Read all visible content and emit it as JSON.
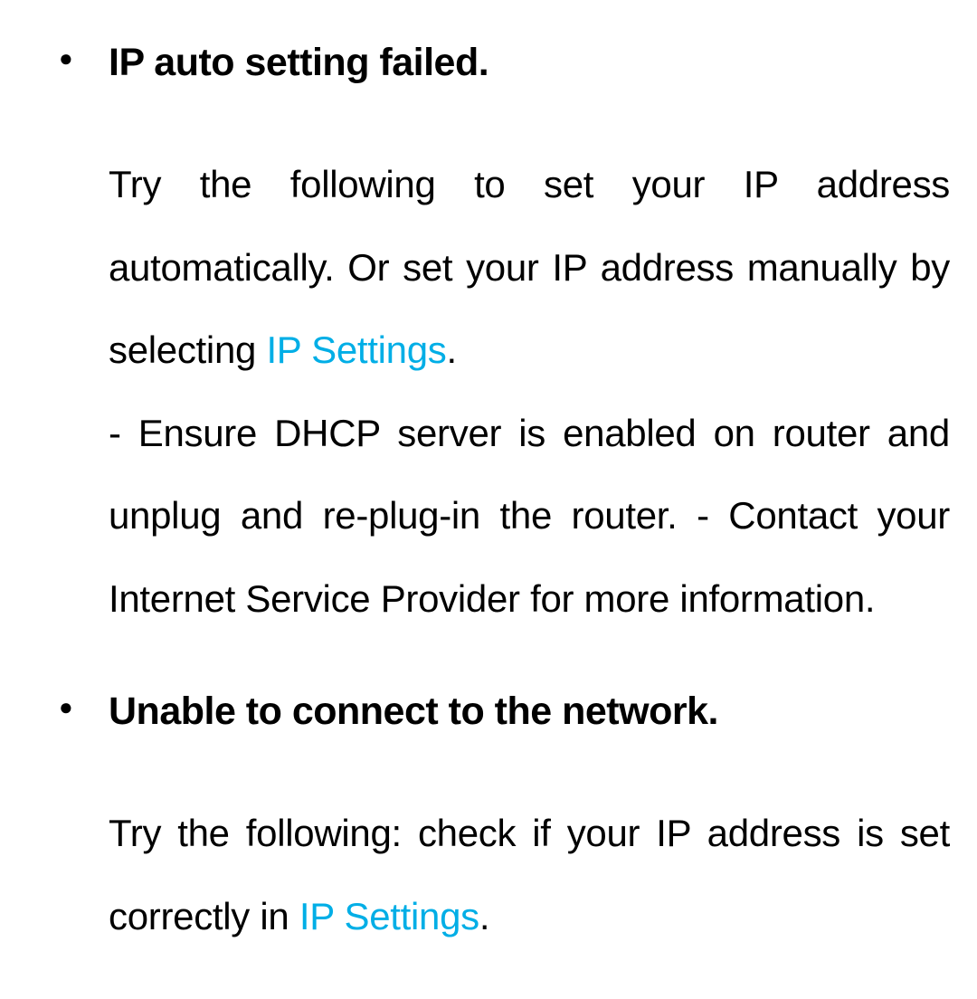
{
  "items": [
    {
      "title": "IP auto setting failed.",
      "body_before_link": "Try the following to set your IP address automatically. Or set your IP address manually by selecting ",
      "link_text": "IP Settings",
      "body_after_link_1": ".",
      "body_line_2": "- Ensure DHCP server is enabled on router and unplug and re-plug-in the router.  - Contact your Internet Service Provider for more information."
    },
    {
      "title": "Unable to connect to the network.",
      "body_before_link": "Try the following: check if your IP address is set correctly in ",
      "link_text": "IP Settings",
      "body_after_link_1": "."
    }
  ]
}
